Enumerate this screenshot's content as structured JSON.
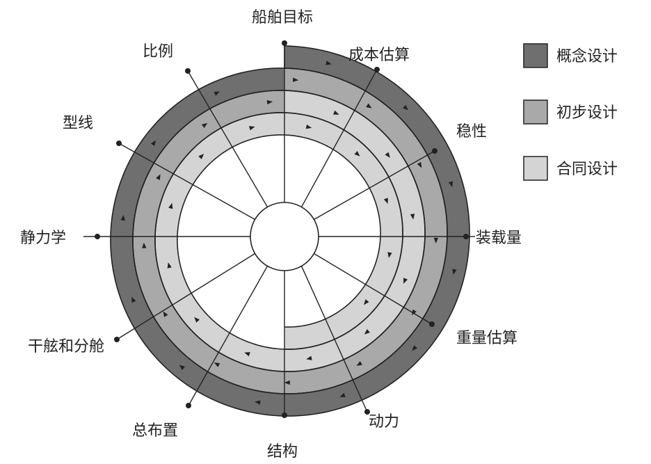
{
  "diagram": {
    "spokes": [
      {
        "label": "船舶目标"
      },
      {
        "label": "成本估算"
      },
      {
        "label": "稳性"
      },
      {
        "label": "装载量"
      },
      {
        "label": "重量估算"
      },
      {
        "label": "动力"
      },
      {
        "label": "结构"
      },
      {
        "label": "总布置"
      },
      {
        "label": "干舷和分舱"
      },
      {
        "label": "静力学"
      },
      {
        "label": "型线"
      },
      {
        "label": "比例"
      }
    ],
    "legend": [
      {
        "label": "概念设计",
        "color": "#6f6f6f"
      },
      {
        "label": "初步设计",
        "color": "#a9a9a9"
      },
      {
        "label": "合同设计",
        "color": "#d4d4d4"
      }
    ]
  }
}
